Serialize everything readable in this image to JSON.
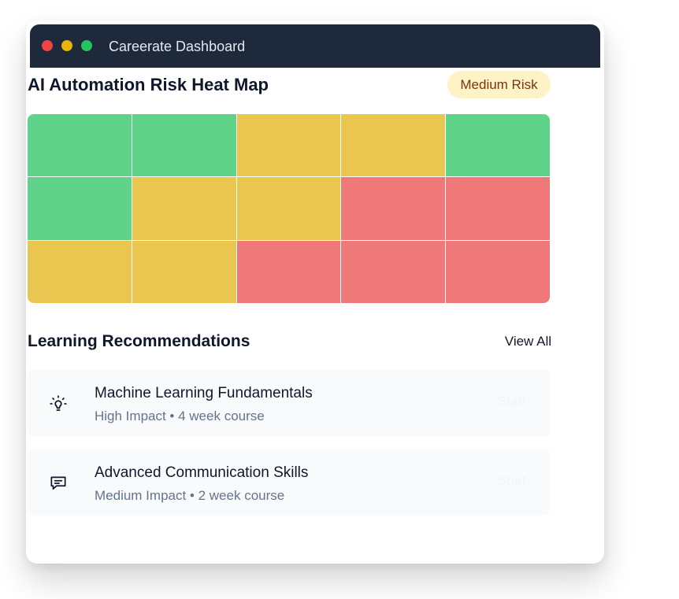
{
  "window": {
    "title": "Careerate Dashboard"
  },
  "heatmap": {
    "title": "AI Automation Risk Heat Map",
    "badge": "Medium Risk",
    "colors": {
      "low": "#5fd38a",
      "medium": "#eac54f",
      "high": "#ef7878"
    },
    "grid": [
      [
        "low",
        "low",
        "medium",
        "medium",
        "low"
      ],
      [
        "low",
        "medium",
        "medium",
        "high",
        "high"
      ],
      [
        "medium",
        "medium",
        "high",
        "high",
        "high"
      ]
    ]
  },
  "recommendations": {
    "title": "Learning Recommendations",
    "view_all": "View All",
    "items": [
      {
        "icon": "lightbulb-icon",
        "name": "Machine Learning Fundamentals",
        "meta": "High Impact • 4 week course",
        "action": "Start"
      },
      {
        "icon": "chat-icon",
        "name": "Advanced Communication Skills",
        "meta": "Medium Impact • 2 week course",
        "action": "Start"
      }
    ]
  }
}
